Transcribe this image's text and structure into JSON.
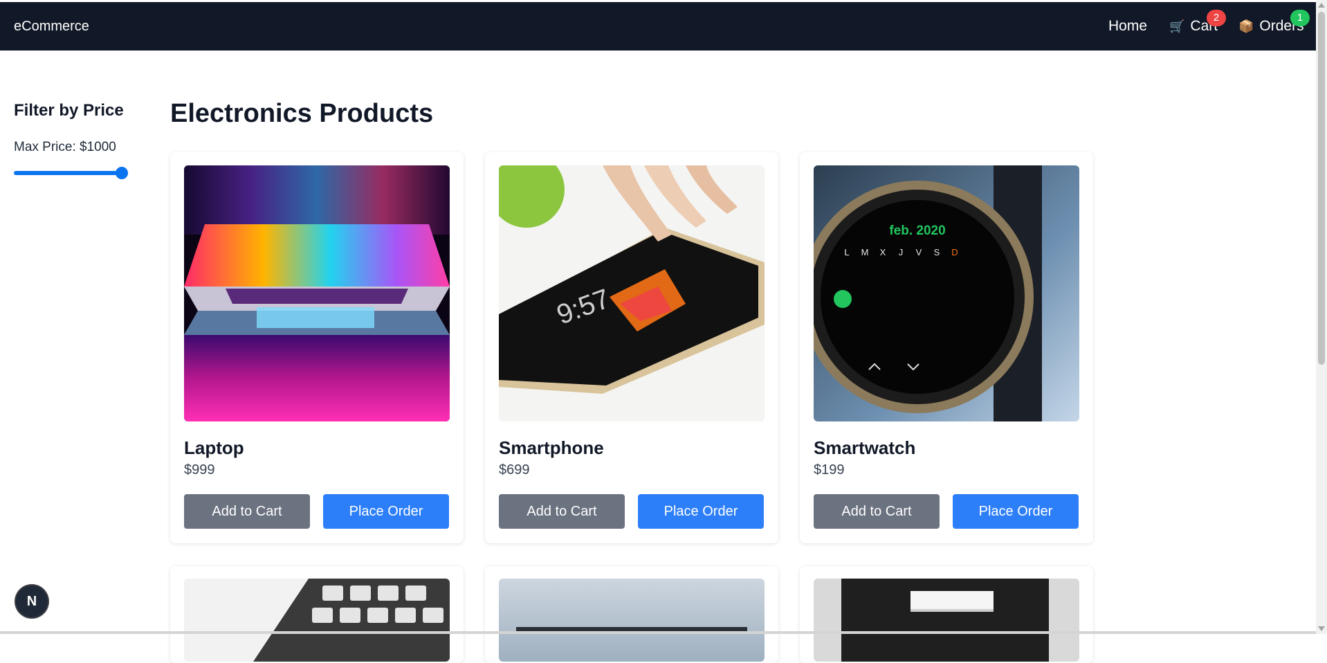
{
  "navbar": {
    "brand": "eCommerce",
    "home_label": "Home",
    "cart_label": "Cart",
    "cart_icon": "shopping-cart-icon",
    "cart_count": "2",
    "orders_label": "Orders",
    "orders_icon": "package-icon",
    "orders_count": "1",
    "background": "#111827"
  },
  "sidebar": {
    "title": "Filter by Price",
    "max_price_label": "Max Price: ",
    "max_price_value": "$1000",
    "slider_fraction": 1.0
  },
  "main": {
    "title": "Electronics Products",
    "products": [
      {
        "name": "Laptop",
        "price": "$999",
        "image": "laptop-image"
      },
      {
        "name": "Smartphone",
        "price": "$699",
        "image": "smartphone-image"
      },
      {
        "name": "Smartwatch",
        "price": "$199",
        "image": "smartwatch-image"
      }
    ],
    "add_to_cart_label": "Add to Cart",
    "place_order_label": "Place Order"
  },
  "watch_face": {
    "month": "feb. 2020",
    "days_header": [
      "L",
      "M",
      "X",
      "J",
      "V",
      "S",
      "D"
    ]
  },
  "phone_screen": {
    "time": "9:57"
  },
  "dev_badge": "N",
  "colors": {
    "accent_blue": "#2d7ff9",
    "secondary_gray": "#6b7280",
    "cart_badge": "#ef4444",
    "orders_badge": "#22c55e"
  }
}
